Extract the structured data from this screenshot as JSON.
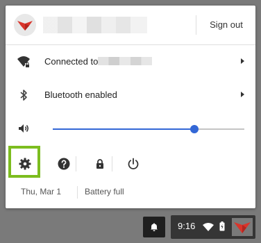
{
  "header": {
    "sign_out_label": "Sign out"
  },
  "network": {
    "label": "Connected to",
    "icon": "wifi-lock-icon"
  },
  "bluetooth": {
    "label": "Bluetooth enabled",
    "icon": "bluetooth-icon"
  },
  "volume": {
    "icon": "volume-icon",
    "level_percent": 74
  },
  "actions": [
    {
      "name": "settings-button",
      "icon": "gear-icon"
    },
    {
      "name": "help-button",
      "icon": "help-icon"
    },
    {
      "name": "lock-button",
      "icon": "lock-icon"
    },
    {
      "name": "power-button",
      "icon": "power-icon"
    }
  ],
  "footer": {
    "date": "Thu, Mar 1",
    "battery": "Battery full"
  },
  "shelf": {
    "time": "9:16"
  },
  "colors": {
    "accent": "#3367d6",
    "highlight": "#7cbd1f",
    "logo_red": "#d9342b"
  }
}
